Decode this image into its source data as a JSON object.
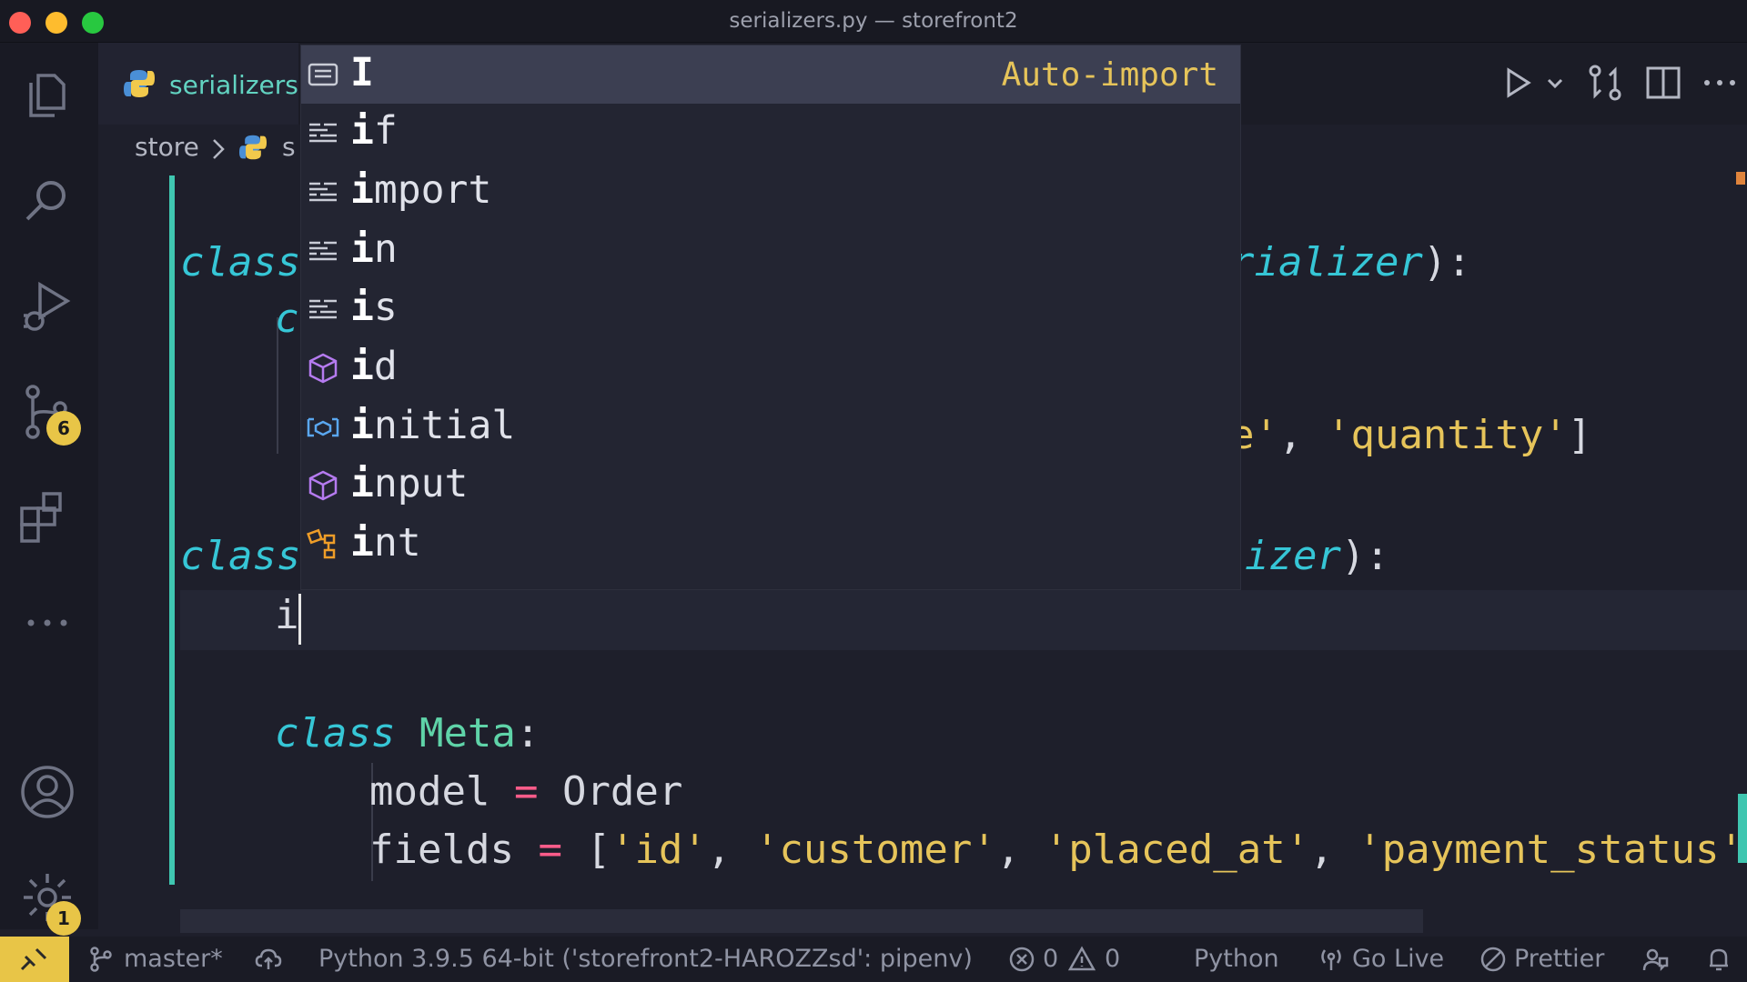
{
  "window": {
    "title": "serializers.py — storefront2",
    "traffic_colors": {
      "close": "#ff5f57",
      "minimize": "#febc2e",
      "maximize": "#28c840"
    }
  },
  "activity_bar": {
    "source_control_badge": "6",
    "settings_badge": "1"
  },
  "tabs": [
    {
      "label": "serializers.py",
      "visible_label": "serializers"
    }
  ],
  "breadcrumb": {
    "folder": "store",
    "file_partial": "s"
  },
  "editor": {
    "lines": {
      "l1_kw": "class",
      "l1_tail": "rializer",
      "l1_end": "):",
      "l2_partial": "c",
      "l3_str_tail": "e'",
      "l3_sep": ", ",
      "l3_str": "'quantity'",
      "l3_end": "]",
      "l4_kw": "class",
      "l4_tail": "izer",
      "l4_end": "):",
      "l5_typed": "i",
      "l6_kw": "class",
      "l6_name": "Meta",
      "l6_colon": ":",
      "l7_name": "model",
      "l7_op": "=",
      "l7_val": "Order",
      "l8_name": "fields",
      "l8_op": "=",
      "l8_open": "[",
      "l8_s1": "'id'",
      "l8_s2": "'customer'",
      "l8_s3": "'placed_at'",
      "l8_s4": "'payment_status'",
      "l8_comma": ", ",
      "l8_trail": ","
    }
  },
  "suggestions": [
    {
      "match": "I",
      "rest": "",
      "kind": "text-icon",
      "detail": "Auto-import",
      "selected": true
    },
    {
      "match": "i",
      "rest": "f",
      "kind": "keyword-icon",
      "detail": "",
      "selected": false
    },
    {
      "match": "i",
      "rest": "mport",
      "kind": "keyword-icon",
      "detail": "",
      "selected": false
    },
    {
      "match": "i",
      "rest": "n",
      "kind": "keyword-icon",
      "detail": "",
      "selected": false
    },
    {
      "match": "i",
      "rest": "s",
      "kind": "keyword-icon",
      "detail": "",
      "selected": false
    },
    {
      "match": "i",
      "rest": "d",
      "kind": "function-icon",
      "detail": "",
      "selected": false
    },
    {
      "match": "i",
      "rest": "nitial",
      "kind": "variable-icon",
      "detail": "",
      "selected": false
    },
    {
      "match": "i",
      "rest": "nput",
      "kind": "function-icon",
      "detail": "",
      "selected": false
    },
    {
      "match": "i",
      "rest": "nt",
      "kind": "class-icon",
      "detail": "",
      "selected": false
    }
  ],
  "status_bar": {
    "branch": "master*",
    "interpreter": "Python 3.9.5 64-bit ('storefront2-HAROZZsd': pipenv)",
    "errors": "0",
    "warnings": "0",
    "language": "Python",
    "go_live": "Go Live",
    "prettier": "Prettier"
  },
  "colors": {
    "accent": "#3fc6b0",
    "badge": "#e8c547",
    "string": "#e6c45a",
    "keyword": "#36c6d6",
    "operator": "#ff5c8a"
  }
}
